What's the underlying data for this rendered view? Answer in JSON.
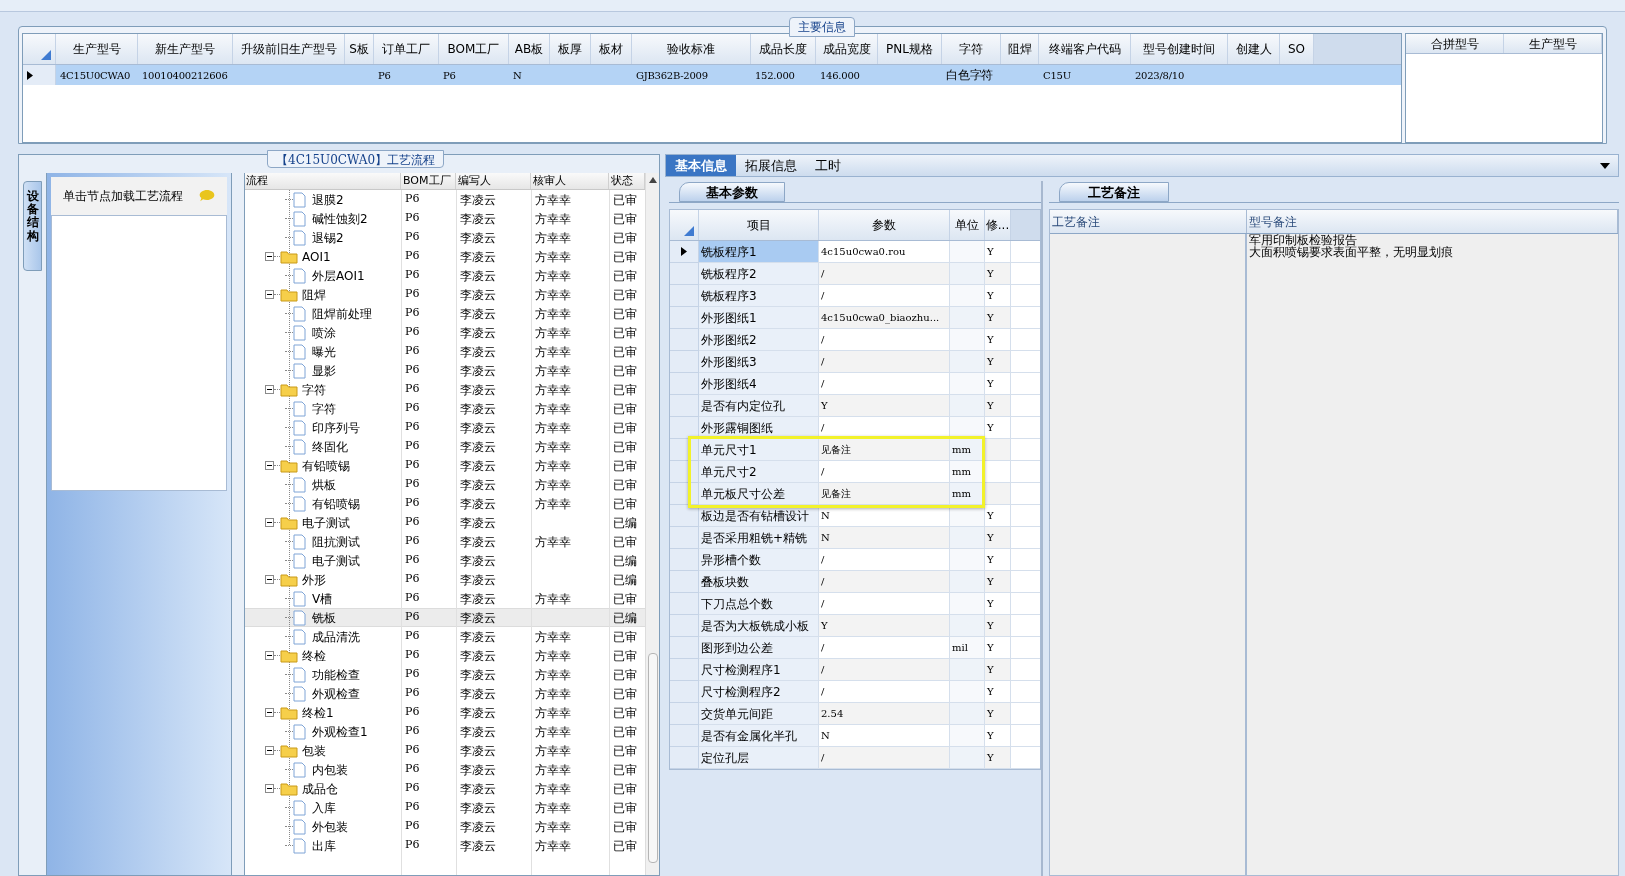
{
  "main_info": {
    "title": "主要信息",
    "columns": [
      "生产型号",
      "新生产型号",
      "升级前旧生产型号",
      "S板",
      "订单工厂",
      "BOM工厂",
      "AB板",
      "板厚",
      "板材",
      "验收标准",
      "成品长度",
      "成品宽度",
      "PNL规格",
      "字符",
      "阻焊",
      "终端客户代码",
      "型号创建时间",
      "创建人",
      "SO"
    ],
    "rows": [
      {
        "selected": true,
        "cells": [
          "4C15U0CWA0",
          "10010400212606",
          null,
          null,
          "P6",
          "P6",
          "N",
          null,
          null,
          "GJB362B-2009",
          "152.000",
          "146.000",
          null,
          "白色字符",
          null,
          "C15U",
          "2023/8/10",
          null,
          null
        ]
      }
    ],
    "merge_columns": [
      "合拼型号",
      "生产型号"
    ]
  },
  "process": {
    "title": "【4C15U0CWA0】工艺流程",
    "side_tab": "设备结构",
    "hint": "单击节点加载工艺流程",
    "columns": [
      "流程",
      "BOM工厂",
      "编写人",
      "核审人",
      "状态"
    ],
    "nodes": [
      {
        "kind": "file",
        "name": "退膜2",
        "bom": "P6",
        "writer": "李凌云",
        "reviewer": "方幸幸",
        "status": "已审",
        "selected": false
      },
      {
        "kind": "file",
        "name": "碱性蚀刻2",
        "bom": "P6",
        "writer": "李凌云",
        "reviewer": "方幸幸",
        "status": "已审",
        "selected": false
      },
      {
        "kind": "file",
        "name": "退锡2",
        "bom": "P6",
        "writer": "李凌云",
        "reviewer": "方幸幸",
        "status": "已审",
        "selected": false
      },
      {
        "kind": "folder",
        "name": "AOI1",
        "bom": "P6",
        "writer": "李凌云",
        "reviewer": "方幸幸",
        "status": "已审",
        "selected": false,
        "expanded": true,
        "children": [
          {
            "kind": "file",
            "name": "外层AOI1",
            "bom": "P6",
            "writer": "李凌云",
            "reviewer": "方幸幸",
            "status": "已审",
            "selected": false
          }
        ]
      },
      {
        "kind": "folder",
        "name": "阻焊",
        "bom": "P6",
        "writer": "李凌云",
        "reviewer": "方幸幸",
        "status": "已审",
        "selected": false,
        "expanded": true,
        "children": [
          {
            "kind": "file",
            "name": "阻焊前处理",
            "bom": "P6",
            "writer": "李凌云",
            "reviewer": "方幸幸",
            "status": "已审",
            "selected": false
          },
          {
            "kind": "file",
            "name": "喷涂",
            "bom": "P6",
            "writer": "李凌云",
            "reviewer": "方幸幸",
            "status": "已审",
            "selected": false
          },
          {
            "kind": "file",
            "name": "曝光",
            "bom": "P6",
            "writer": "李凌云",
            "reviewer": "方幸幸",
            "status": "已审",
            "selected": false
          },
          {
            "kind": "file",
            "name": "显影",
            "bom": "P6",
            "writer": "李凌云",
            "reviewer": "方幸幸",
            "status": "已审",
            "selected": false
          }
        ]
      },
      {
        "kind": "folder",
        "name": "字符",
        "bom": "P6",
        "writer": "李凌云",
        "reviewer": "方幸幸",
        "status": "已审",
        "selected": false,
        "expanded": true,
        "children": [
          {
            "kind": "file",
            "name": "字符",
            "bom": "P6",
            "writer": "李凌云",
            "reviewer": "方幸幸",
            "status": "已审",
            "selected": false
          },
          {
            "kind": "file",
            "name": "印序列号",
            "bom": "P6",
            "writer": "李凌云",
            "reviewer": "方幸幸",
            "status": "已审",
            "selected": false
          },
          {
            "kind": "file",
            "name": "终固化",
            "bom": "P6",
            "writer": "李凌云",
            "reviewer": "方幸幸",
            "status": "已审",
            "selected": false
          }
        ]
      },
      {
        "kind": "folder",
        "name": "有铅喷锡",
        "bom": "P6",
        "writer": "李凌云",
        "reviewer": "方幸幸",
        "status": "已审",
        "selected": false,
        "expanded": true,
        "children": [
          {
            "kind": "file",
            "name": "烘板",
            "bom": "P6",
            "writer": "李凌云",
            "reviewer": "方幸幸",
            "status": "已审",
            "selected": false
          },
          {
            "kind": "file",
            "name": "有铅喷锡",
            "bom": "P6",
            "writer": "李凌云",
            "reviewer": "方幸幸",
            "status": "已审",
            "selected": false
          }
        ]
      },
      {
        "kind": "folder",
        "name": "电子测试",
        "bom": "P6",
        "writer": "李凌云",
        "status": "已编",
        "selected": false,
        "expanded": true,
        "children": [
          {
            "kind": "file",
            "name": "阻抗测试",
            "bom": "P6",
            "writer": "李凌云",
            "reviewer": "方幸幸",
            "status": "已审",
            "selected": false
          },
          {
            "kind": "file",
            "name": "电子测试",
            "bom": "P6",
            "writer": "李凌云",
            "status": "已编",
            "selected": false
          }
        ]
      },
      {
        "kind": "folder",
        "name": "外形",
        "bom": "P6",
        "writer": "李凌云",
        "status": "已编",
        "selected": false,
        "expanded": true,
        "children": [
          {
            "kind": "file",
            "name": "V槽",
            "bom": "P6",
            "writer": "李凌云",
            "reviewer": "方幸幸",
            "status": "已审",
            "selected": false
          },
          {
            "kind": "file",
            "name": "铣板",
            "bom": "P6",
            "writer": "李凌云",
            "status": "已编",
            "selected": true
          },
          {
            "kind": "file",
            "name": "成品清洗",
            "bom": "P6",
            "writer": "李凌云",
            "reviewer": "方幸幸",
            "status": "已审",
            "selected": false
          }
        ]
      },
      {
        "kind": "folder",
        "name": "终检",
        "bom": "P6",
        "writer": "李凌云",
        "reviewer": "方幸幸",
        "status": "已审",
        "selected": false,
        "expanded": true,
        "children": [
          {
            "kind": "file",
            "name": "功能检查",
            "bom": "P6",
            "writer": "李凌云",
            "reviewer": "方幸幸",
            "status": "已审",
            "selected": false
          },
          {
            "kind": "file",
            "name": "外观检查",
            "bom": "P6",
            "writer": "李凌云",
            "reviewer": "方幸幸",
            "status": "已审",
            "selected": false
          }
        ]
      },
      {
        "kind": "folder",
        "name": "终检1",
        "bom": "P6",
        "writer": "李凌云",
        "reviewer": "方幸幸",
        "status": "已审",
        "selected": false,
        "expanded": true,
        "children": [
          {
            "kind": "file",
            "name": "外观检查1",
            "bom": "P6",
            "writer": "李凌云",
            "reviewer": "方幸幸",
            "status": "已审",
            "selected": false
          }
        ]
      },
      {
        "kind": "folder",
        "name": "包装",
        "bom": "P6",
        "writer": "李凌云",
        "reviewer": "方幸幸",
        "status": "已审",
        "selected": false,
        "expanded": true,
        "children": [
          {
            "kind": "file",
            "name": "内包装",
            "bom": "P6",
            "writer": "李凌云",
            "reviewer": "方幸幸",
            "status": "已审",
            "selected": false
          }
        ]
      },
      {
        "kind": "folder",
        "name": "成品仓",
        "bom": "P6",
        "writer": "李凌云",
        "reviewer": "方幸幸",
        "status": "已审",
        "selected": false,
        "expanded": true,
        "children": [
          {
            "kind": "file",
            "name": "入库",
            "bom": "P6",
            "writer": "李凌云",
            "reviewer": "方幸幸",
            "status": "已审",
            "selected": false
          },
          {
            "kind": "file",
            "name": "外包装",
            "bom": "P6",
            "writer": "李凌云",
            "reviewer": "方幸幸",
            "status": "已审",
            "selected": false
          },
          {
            "kind": "file",
            "name": "出库",
            "bom": "P6",
            "writer": "李凌云",
            "reviewer": "方幸幸",
            "status": "已审",
            "selected": false
          }
        ]
      }
    ]
  },
  "tabs": [
    {
      "label": "基本信息",
      "selected": true
    },
    {
      "label": "拓展信息",
      "selected": false
    },
    {
      "label": "工时",
      "selected": false
    }
  ],
  "params": {
    "tab": "基本参数",
    "columns": [
      "项目",
      "参数",
      "单位",
      "修..."
    ],
    "rows": [
      {
        "item": "铣板程序1",
        "value": "4c15u0cwa0.rou",
        "mod": "Y",
        "selected": true,
        "highlighted": false
      },
      {
        "item": "铣板程序2",
        "value": "/",
        "mod": "Y",
        "selected": false,
        "highlighted": false
      },
      {
        "item": "铣板程序3",
        "value": "/",
        "mod": "Y",
        "selected": false,
        "highlighted": false
      },
      {
        "item": "外形图纸1",
        "value": "4c15u0cwa0_biaozhu...",
        "mod": "Y",
        "selected": false,
        "highlighted": false
      },
      {
        "item": "外形图纸2",
        "value": "/",
        "mod": "Y",
        "selected": false,
        "highlighted": false
      },
      {
        "item": "外形图纸3",
        "value": "/",
        "mod": "Y",
        "selected": false,
        "highlighted": false
      },
      {
        "item": "外形图纸4",
        "value": "/",
        "mod": "Y",
        "selected": false,
        "highlighted": false
      },
      {
        "item": "是否有内定位孔",
        "value": "Y",
        "mod": "Y",
        "selected": false,
        "highlighted": false
      },
      {
        "item": "外形露铜图纸",
        "value": "/",
        "mod": "Y",
        "selected": false,
        "highlighted": false
      },
      {
        "item": "单元尺寸1",
        "value": "见备注",
        "unit": "mm",
        "selected": false,
        "highlighted": true
      },
      {
        "item": "单元尺寸2",
        "value": "/",
        "unit": "mm",
        "selected": false,
        "highlighted": true
      },
      {
        "item": "单元板尺寸公差",
        "value": "见备注",
        "unit": "mm",
        "selected": false,
        "highlighted": true
      },
      {
        "item": "板边是否有钻槽设计",
        "value": "N",
        "mod": "Y",
        "selected": false,
        "highlighted": false
      },
      {
        "item": "是否采用粗铣+精铣",
        "value": "N",
        "mod": "Y",
        "selected": false,
        "highlighted": false
      },
      {
        "item": "异形槽个数",
        "value": "/",
        "mod": "Y",
        "selected": false,
        "highlighted": false
      },
      {
        "item": "叠板块数",
        "value": "/",
        "mod": "Y",
        "selected": false,
        "highlighted": false
      },
      {
        "item": "下刀点总个数",
        "value": "/",
        "mod": "Y",
        "selected": false,
        "highlighted": false
      },
      {
        "item": "是否为大板铣成小板",
        "value": "Y",
        "mod": "Y",
        "selected": false,
        "highlighted": false
      },
      {
        "item": "图形到边公差",
        "value": "/",
        "unit": "mil",
        "mod": "Y",
        "selected": false,
        "highlighted": false
      },
      {
        "item": "尺寸检测程序1",
        "value": "/",
        "mod": "Y",
        "selected": false,
        "highlighted": false
      },
      {
        "item": "尺寸检测程序2",
        "value": "/",
        "mod": "Y",
        "selected": false,
        "highlighted": false
      },
      {
        "item": "交货单元间距",
        "value": "2.54",
        "mod": "Y",
        "selected": false,
        "highlighted": false
      },
      {
        "item": "是否有金属化半孔",
        "value": "N",
        "mod": "Y",
        "selected": false,
        "highlighted": false
      },
      {
        "item": "定位孔层",
        "value": "/",
        "mod": "Y",
        "selected": false,
        "highlighted": false
      }
    ]
  },
  "notes": {
    "tab": "工艺备注",
    "columns": [
      "工艺备注",
      "型号备注"
    ],
    "model_notes": [
      "军用印制板检验报告",
      "大面积喷锡要求表面平整，无明显划痕"
    ]
  }
}
